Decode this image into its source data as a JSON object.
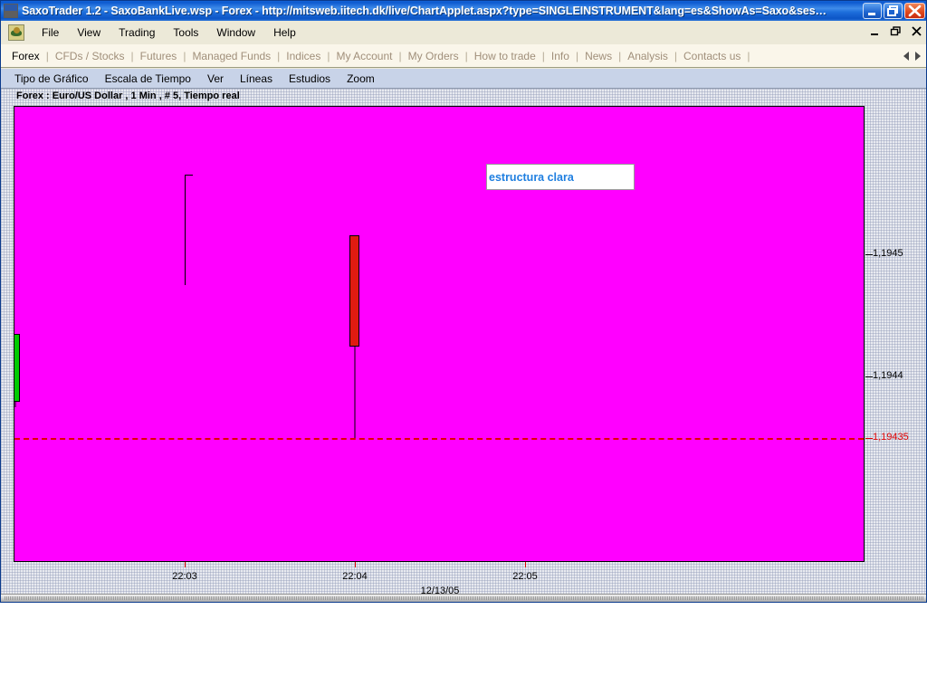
{
  "window": {
    "title": "SaxoTrader 1.2 - SaxoBankLive.wsp - Forex - http://mitsweb.iitech.dk/live/ChartApplet.aspx?type=SINGLEINSTRUMENT&lang=es&ShowAs=Saxo&ses…",
    "app_icon": "saxo-bank-logo-icon",
    "controls": {
      "minimize": "minimize-icon",
      "restore": "restore-icon",
      "close": "close-icon"
    }
  },
  "menubar": {
    "app_icon": "application-icon",
    "items": [
      {
        "label": "File"
      },
      {
        "label": "View"
      },
      {
        "label": "Trading"
      },
      {
        "label": "Tools"
      },
      {
        "label": "Window"
      },
      {
        "label": "Help"
      }
    ],
    "mdi_controls": {
      "minimize": "mdi-minimize-icon",
      "restore": "mdi-restore-icon",
      "close": "mdi-close-icon"
    }
  },
  "tabstrip": {
    "tabs": [
      {
        "label": "Forex",
        "active": true
      },
      {
        "label": "CFDs / Stocks",
        "active": false
      },
      {
        "label": "Futures",
        "active": false
      },
      {
        "label": "Managed Funds",
        "active": false
      },
      {
        "label": "Indices",
        "active": false
      },
      {
        "label": "My Account",
        "active": false
      },
      {
        "label": "My Orders",
        "active": false
      },
      {
        "label": "How to trade",
        "active": false
      },
      {
        "label": "Info",
        "active": false
      },
      {
        "label": "News",
        "active": false
      },
      {
        "label": "Analysis",
        "active": false
      },
      {
        "label": "Contacts us",
        "active": false
      }
    ],
    "separator": "|",
    "scroll_left": "scroll-left-icon",
    "scroll_right": "scroll-right-icon"
  },
  "chartmenu": {
    "items": [
      {
        "label": "Tipo de Gráfico"
      },
      {
        "label": "Escala de Tiempo"
      },
      {
        "label": "Ver"
      },
      {
        "label": "Líneas"
      },
      {
        "label": "Estudios"
      },
      {
        "label": "Zoom"
      }
    ]
  },
  "chart": {
    "header": "Forex : Euro/US Dollar , 1 Min , # 5, Tiempo real",
    "annotation": "estructura clara",
    "annotation_color": "#1f7fe0",
    "plot_background": "#ff00ff",
    "up_color": "#00cc00",
    "down_color": "#e01b10",
    "price_line_color": "#e00000"
  },
  "chart_data": {
    "type": "candlestick",
    "title": "Forex : Euro/US Dollar , 1 Min , # 5, Tiempo real",
    "instrument": "Euro/US Dollar",
    "market": "Forex",
    "interval": "1 Min",
    "chart_number": "# 5",
    "mode": "Tiempo real",
    "date": "12/13/05",
    "xlabel": "12/13/05",
    "ylabel": "",
    "x_ticks": [
      "22:03",
      "22:04",
      "22:05"
    ],
    "y_ticks": [
      "1,1945",
      "1,1944"
    ],
    "ylim": [
      1.19425,
      1.19462
    ],
    "current_price": "1,19435",
    "current_price_value": 1.19435,
    "grid": false,
    "legend": false,
    "annotations": [
      {
        "text": "estructura clara",
        "color": "#1f7fe0"
      }
    ],
    "candles": [
      {
        "time": "22:02",
        "open": 1.19438,
        "high": 1.194435,
        "low": 1.194375,
        "close": 1.194435,
        "direction": "up",
        "color": "#00cc00"
      },
      {
        "time": "22:03",
        "open": 1.19452,
        "high": 1.194565,
        "low": 1.194475,
        "close": 1.194475,
        "direction": "doji",
        "color": "#000000"
      },
      {
        "time": "22:04",
        "open": 1.194515,
        "high": 1.194515,
        "low": 1.19435,
        "close": 1.194425,
        "direction": "down",
        "color": "#e01b10"
      }
    ]
  }
}
